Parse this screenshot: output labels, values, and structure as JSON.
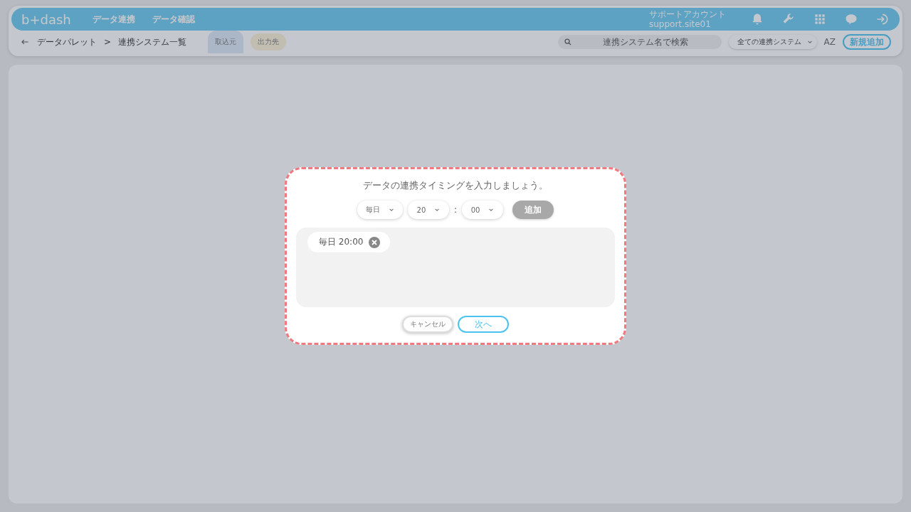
{
  "header": {
    "logo": "b+dash",
    "nav": [
      {
        "label": "データ連携"
      },
      {
        "label": "データ確認"
      }
    ],
    "account": {
      "name": "サポートアカウント",
      "id": "support.site01"
    }
  },
  "toolbar": {
    "breadcrumb": [
      "データパレット",
      "連携システム一覧"
    ],
    "separator": ">",
    "tabs": [
      {
        "label": "取込元",
        "selected": true
      },
      {
        "label": "出力先",
        "selected": false
      }
    ],
    "search": {
      "placeholder": "連携システム名で検索"
    },
    "filter": {
      "value": "全ての連携システム"
    },
    "sort": "AZ",
    "add_button": "新規追加"
  },
  "dialog": {
    "title": "データの連携タイミングを入力しましょう。",
    "frequency": "毎日",
    "hour": "20",
    "colon": ":",
    "minute": "00",
    "add_button": {
      "label": "追加",
      "disabled": true
    },
    "schedules": [
      {
        "label": "毎日 20:00"
      }
    ],
    "cancel": "キャンセル",
    "next": "次へ"
  }
}
